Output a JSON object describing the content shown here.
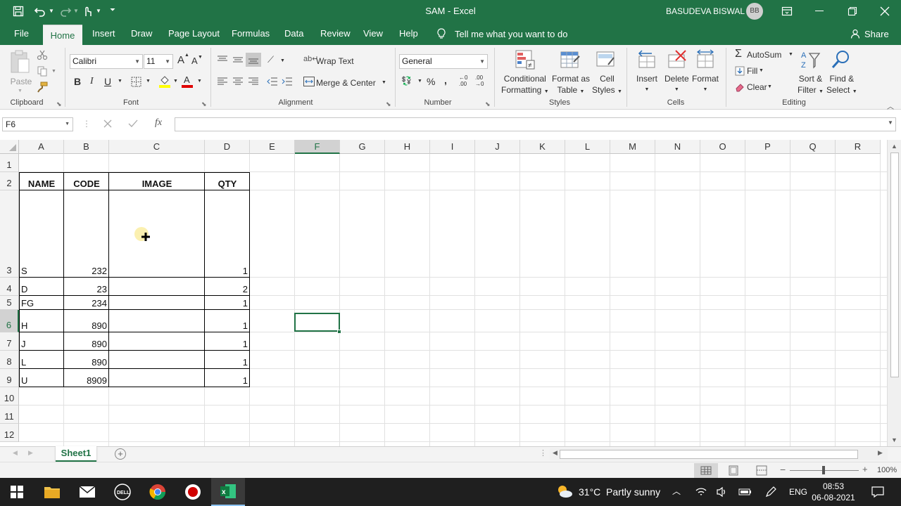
{
  "title_bar": {
    "doc_title": "SAM",
    "separator": "-",
    "app_name": "Excel",
    "user_name": "BASUDEVA BISWAL",
    "user_initials": "BB"
  },
  "tabs": [
    {
      "label": "File"
    },
    {
      "label": "Home"
    },
    {
      "label": "Insert"
    },
    {
      "label": "Draw"
    },
    {
      "label": "Page Layout"
    },
    {
      "label": "Formulas"
    },
    {
      "label": "Data"
    },
    {
      "label": "Review"
    },
    {
      "label": "View"
    },
    {
      "label": "Help"
    }
  ],
  "tell_me": "Tell me what you want to do",
  "share": "Share",
  "ribbon": {
    "clipboard": {
      "paste": "Paste",
      "label": "Clipboard"
    },
    "font": {
      "name": "Calibri",
      "size": "11",
      "grow": "A",
      "shrink": "A",
      "bold": "B",
      "italic": "I",
      "underline": "U",
      "label": "Font"
    },
    "alignment": {
      "wrap_text": "Wrap Text",
      "merge_center": "Merge & Center",
      "label": "Alignment"
    },
    "number": {
      "format": "General",
      "label": "Number"
    },
    "styles": {
      "conditional_1": "Conditional",
      "conditional_2": "Formatting",
      "format_as_1": "Format as",
      "format_as_2": "Table",
      "cell_styles_1": "Cell",
      "cell_styles_2": "Styles",
      "label": "Styles"
    },
    "cells": {
      "insert": "Insert",
      "delete": "Delete",
      "format": "Format",
      "label": "Cells"
    },
    "editing": {
      "autosum": "AutoSum",
      "fill": "Fill",
      "clear": "Clear",
      "sort_1": "Sort &",
      "sort_2": "Filter",
      "find_1": "Find &",
      "find_2": "Select",
      "label": "Editing"
    }
  },
  "formula_bar": {
    "name_box": "F6",
    "fx": "fx",
    "formula": ""
  },
  "columns": [
    "A",
    "B",
    "C",
    "D",
    "E",
    "F",
    "G",
    "H",
    "I",
    "J",
    "K",
    "L",
    "M",
    "N",
    "O",
    "P",
    "Q",
    "R"
  ],
  "rows": [
    "1",
    "2",
    "3",
    "4",
    "5",
    "6",
    "7",
    "8",
    "9",
    "10",
    "11",
    "12"
  ],
  "table": {
    "headers": [
      "NAME",
      "CODE",
      "IMAGE",
      "QTY"
    ],
    "rows": [
      {
        "name": "S",
        "code": "232",
        "image": "",
        "qty": "1"
      },
      {
        "name": "D",
        "code": "23",
        "image": "",
        "qty": "2"
      },
      {
        "name": "FG",
        "code": "234",
        "image": "",
        "qty": "1"
      },
      {
        "name": "H",
        "code": "890",
        "image": "",
        "qty": "1"
      },
      {
        "name": "J",
        "code": "890",
        "image": "",
        "qty": "1"
      },
      {
        "name": "L",
        "code": "890",
        "image": "",
        "qty": "1"
      },
      {
        "name": "U",
        "code": "8909",
        "image": "",
        "qty": "1"
      }
    ]
  },
  "selected_cell": "F6",
  "sheet_tabs": [
    {
      "label": "Sheet1"
    }
  ],
  "status": {
    "zoom": "100%"
  },
  "taskbar": {
    "weather": "31°C  Partly sunny",
    "language": "ENG",
    "time": "08:53",
    "date": "06-08-2021"
  },
  "colors": {
    "accent": "#217346",
    "taskbar": "#1f1f1f"
  }
}
